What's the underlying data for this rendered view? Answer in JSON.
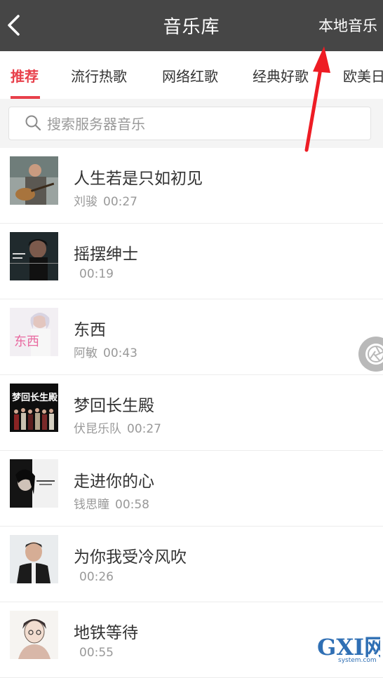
{
  "header": {
    "title": "音乐库",
    "local_music": "本地音乐",
    "back_icon": "chevron-left-icon"
  },
  "tabs": [
    {
      "label": "推荐",
      "active": true
    },
    {
      "label": "流行热歌",
      "active": false
    },
    {
      "label": "网络红歌",
      "active": false
    },
    {
      "label": "经典好歌",
      "active": false
    },
    {
      "label": "欧美日",
      "active": false
    }
  ],
  "search": {
    "placeholder": "搜索服务器音乐",
    "icon": "search-icon"
  },
  "songs": [
    {
      "title": "人生若是只如初见",
      "artist": "刘骏",
      "duration": "00:27"
    },
    {
      "title": "摇摆绅士",
      "artist": "",
      "duration": "00:19"
    },
    {
      "title": "东西",
      "artist": "阿敏",
      "duration": "00:43"
    },
    {
      "title": "梦回长生殿",
      "artist": "伏昆乐队",
      "duration": "00:27"
    },
    {
      "title": "走进你的心",
      "artist": "钱思瞳",
      "duration": "00:58"
    },
    {
      "title": "为你我受冷风吹",
      "artist": "",
      "duration": "00:26"
    },
    {
      "title": "地铁等待",
      "artist": "",
      "duration": "00:55"
    }
  ],
  "cover_texts": {
    "song_3": "东西",
    "song_4": "梦回长生殿"
  },
  "watermark": {
    "brand": "GXI网",
    "domain": "system.com"
  },
  "colors": {
    "header_bg": "#464646",
    "accent": "#e8404b",
    "annotation_arrow": "#ee1c24"
  }
}
